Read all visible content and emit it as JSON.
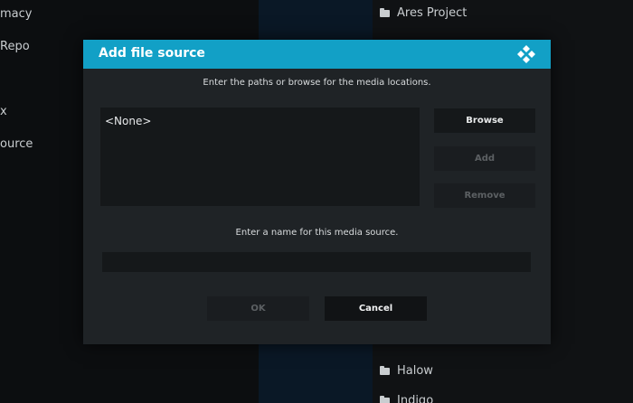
{
  "background": {
    "left_items": [
      "macy",
      "Repo",
      "x",
      "ource"
    ],
    "right_items": [
      {
        "label": "Ares Project",
        "icon": "folder-icon"
      },
      {
        "label": "Halow",
        "icon": "folder-icon"
      },
      {
        "label": "Indigo",
        "icon": "folder-icon"
      }
    ]
  },
  "dialog": {
    "title": "Add file source",
    "paths_instruction": "Enter the paths or browse for the media locations.",
    "paths": [
      "<None>"
    ],
    "browse_label": "Browse",
    "add_label": "Add",
    "remove_label": "Remove",
    "name_instruction": "Enter a name for this media source.",
    "name_value": "",
    "ok_label": "OK",
    "cancel_label": "Cancel"
  },
  "colors": {
    "header": "#12a0c6",
    "dialog_bg": "#1f2326",
    "disabled_text": "#5c6063"
  }
}
